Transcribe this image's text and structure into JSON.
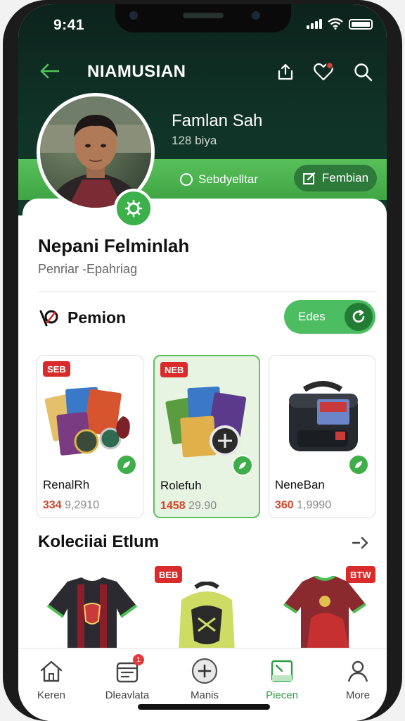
{
  "status_bar": {
    "time": "9:41"
  },
  "header": {
    "title": "NIAMUSIAN"
  },
  "profile": {
    "name": "Famlan Sah",
    "subtitle": "128 biya",
    "follow_label": "Sebdyelltar",
    "edit_label": "Fembian"
  },
  "section": {
    "title": "Nepani Felminlah",
    "subtitle": "Penriar -Epahriag"
  },
  "premium": {
    "title": "Pemion",
    "toggle_label": "Edes"
  },
  "products": [
    {
      "tag": "SEB",
      "name": "RenalRh",
      "price_highlight": "334",
      "price_rest": "9,2910"
    },
    {
      "tag": "NEB",
      "name": "Rolefuh",
      "price_highlight": "1458",
      "price_rest": "29.90"
    },
    {
      "tag": "",
      "name": "NeneBan",
      "price_highlight": "360",
      "price_rest": "1,9990"
    }
  ],
  "collection": {
    "title": "Koleciiai Etlum",
    "tags": [
      "BEB",
      "BTW"
    ]
  },
  "tabs": [
    {
      "label": "Keren",
      "icon": "home-icon"
    },
    {
      "label": "Dleavlata",
      "icon": "list-icon",
      "badge": "1"
    },
    {
      "label": "Manis",
      "icon": "plus-icon"
    },
    {
      "label": "Piecen",
      "icon": "collection-icon",
      "active": true
    },
    {
      "label": "More",
      "icon": "profile-icon"
    }
  ],
  "colors": {
    "header_bg": "#0f2f25",
    "accent_green": "#3fae4a",
    "tag_red": "#d92b2b",
    "price_red": "#d6452b"
  }
}
